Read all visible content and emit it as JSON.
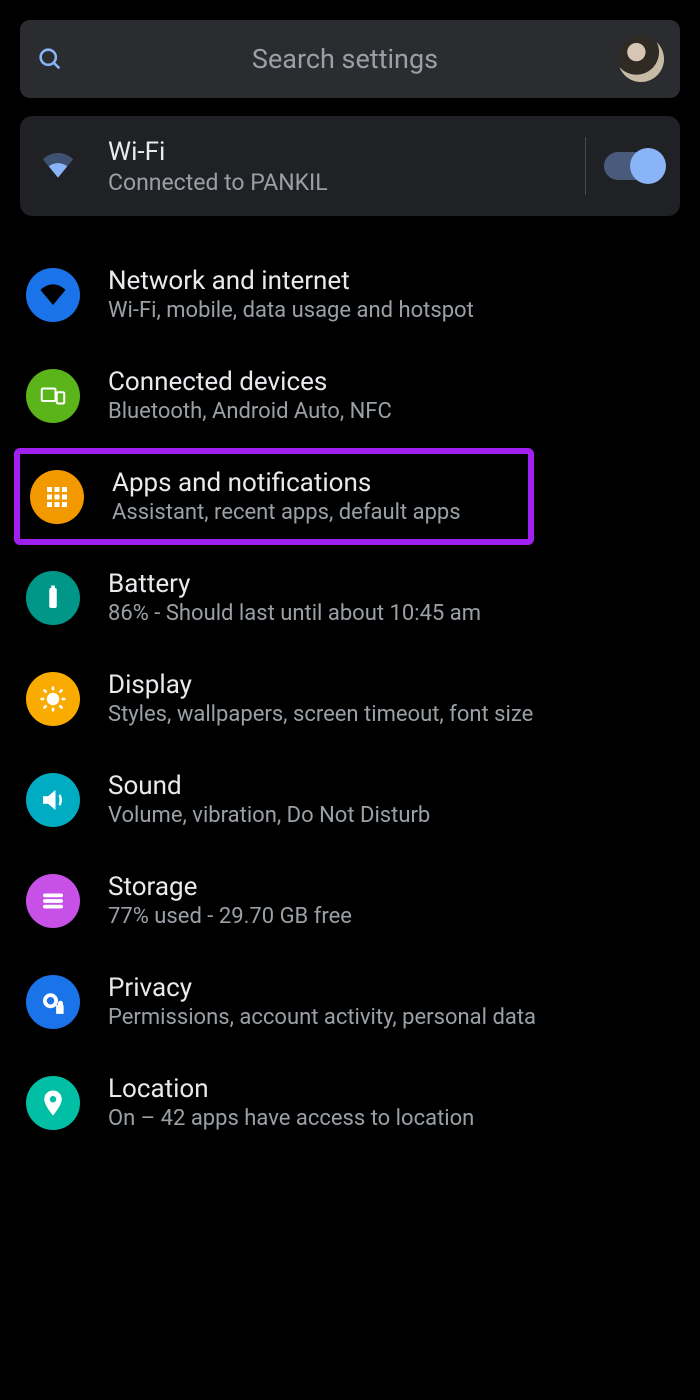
{
  "search": {
    "placeholder": "Search settings"
  },
  "wifi": {
    "title": "Wi-Fi",
    "subtitle": "Connected to PANKIL",
    "enabled": true
  },
  "items": [
    {
      "title": "Network and internet",
      "subtitle": "Wi-Fi, mobile, data usage and hotspot",
      "color": "c-blue",
      "icon": "wifi-icon",
      "highlighted": false
    },
    {
      "title": "Connected devices",
      "subtitle": "Bluetooth, Android Auto, NFC",
      "color": "c-green",
      "icon": "devices-icon",
      "highlighted": false
    },
    {
      "title": "Apps and notifications",
      "subtitle": "Assistant, recent apps, default apps",
      "color": "c-orange",
      "icon": "apps-icon",
      "highlighted": true
    },
    {
      "title": "Battery",
      "subtitle": "86% - Should last until about 10:45 am",
      "color": "c-teal",
      "icon": "battery-icon",
      "highlighted": false
    },
    {
      "title": "Display",
      "subtitle": "Styles, wallpapers, screen timeout, font size",
      "color": "c-amber",
      "icon": "brightness-icon",
      "highlighted": false
    },
    {
      "title": "Sound",
      "subtitle": "Volume, vibration, Do Not Disturb",
      "color": "c-cyan",
      "icon": "sound-icon",
      "highlighted": false
    },
    {
      "title": "Storage",
      "subtitle": "77% used - 29.70 GB free",
      "color": "c-purple",
      "icon": "storage-icon",
      "highlighted": false
    },
    {
      "title": "Privacy",
      "subtitle": "Permissions, account activity, personal data",
      "color": "c-bluec",
      "icon": "privacy-icon",
      "highlighted": false
    },
    {
      "title": "Location",
      "subtitle": "On – 42 apps have access to location",
      "color": "c-tealc",
      "icon": "location-icon",
      "highlighted": false
    }
  ]
}
